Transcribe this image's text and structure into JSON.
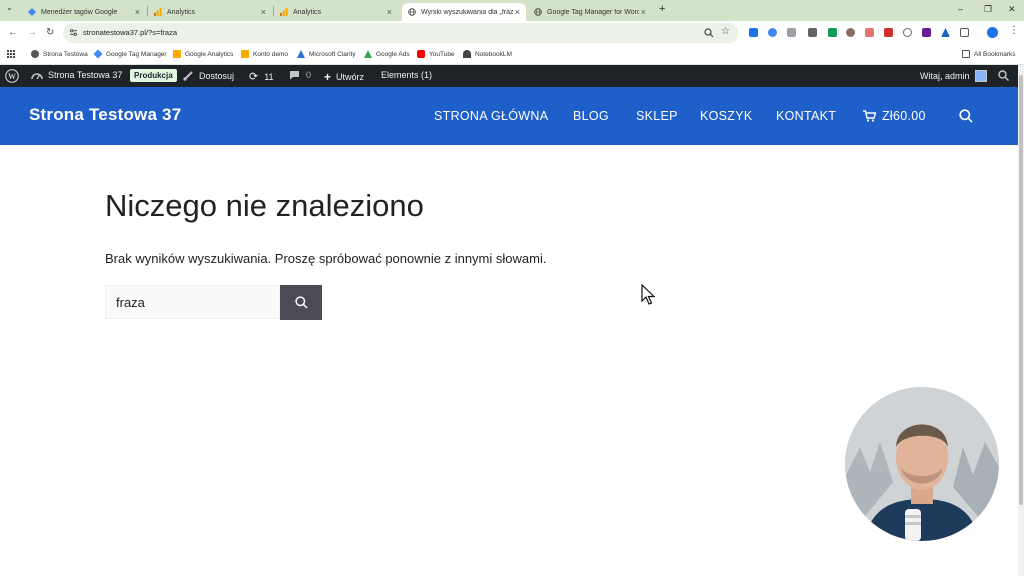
{
  "browser": {
    "tabs": [
      {
        "title": "Menedżer tagów Google",
        "fav_color": "#4285f4"
      },
      {
        "title": "Analytics",
        "fav_color": "#f9ab00"
      },
      {
        "title": "Analytics",
        "fav_color": "#f9ab00"
      },
      {
        "title": "Wyniki wyszukiwania dla „fraza",
        "fav_color": "#555555"
      },
      {
        "title": "Google Tag Manager for WordP",
        "fav_color": "#555555"
      }
    ],
    "url": "stronatestowa37.pl/?s=fraza",
    "bookmarks": [
      {
        "label": "Strona Testowa",
        "color": "#555555"
      },
      {
        "label": "Google Tag Manager",
        "color": "#4285f4"
      },
      {
        "label": "Google Analytics",
        "color": "#f9ab00"
      },
      {
        "label": "Konto demo",
        "color": "#f9ab00"
      },
      {
        "label": "Microsoft Clarity",
        "color": "#2b6fd6"
      },
      {
        "label": "Google Ads",
        "color": "#34a853"
      },
      {
        "label": "YouTube",
        "color": "#ff0000"
      },
      {
        "label": "NotebookLM",
        "color": "#444444"
      }
    ],
    "all_bookmarks": "All Bookmarks"
  },
  "wpadmin": {
    "site_name": "Strona Testowa 37",
    "env_badge": "Produkcja",
    "customize": "Dostosuj",
    "updates_count": "11",
    "comments_count": "0",
    "new_label": "Utwórz",
    "elements_label": "Elements (1)",
    "greeting": "Witaj, admin"
  },
  "site": {
    "title": "Strona Testowa 37",
    "menu": [
      "STRONA GŁÓWNA",
      "BLOG",
      "SKLEP",
      "KOSZYK",
      "KONTAKT"
    ],
    "cart_total": "Zł60.00"
  },
  "content": {
    "heading": "Niczego nie znaleziono",
    "message": "Brak wyników wyszukiwania. Proszę spróbować ponownie z innymi słowami.",
    "search_value": "fraza"
  },
  "colors": {
    "header_bg": "#1e5fc9",
    "admin_bar_bg": "#1d2327",
    "search_button": "#4b4b56"
  }
}
